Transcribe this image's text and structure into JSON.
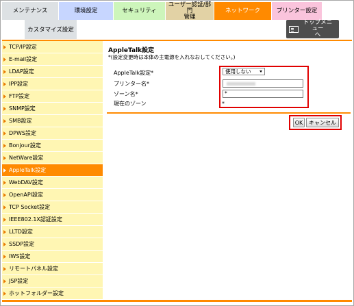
{
  "tabs": [
    {
      "label": "メンテナンス"
    },
    {
      "label": "環境設定"
    },
    {
      "label": "セキュリティ"
    },
    {
      "label": "ユーザー認証/部門\n管理"
    },
    {
      "label": "ネットワーク"
    },
    {
      "label": "プリンター設定"
    }
  ],
  "custom_tab": {
    "label": "カスタマイズ設定"
  },
  "top_menu": {
    "label": "トップメニュー\nへ"
  },
  "sidebar": {
    "items": [
      {
        "label": "TCP/IP設定"
      },
      {
        "label": "E-mail設定"
      },
      {
        "label": "LDAP設定"
      },
      {
        "label": "IPP設定"
      },
      {
        "label": "FTP設定"
      },
      {
        "label": "SNMP設定"
      },
      {
        "label": "SMB設定"
      },
      {
        "label": "DPWS設定"
      },
      {
        "label": "Bonjour設定"
      },
      {
        "label": "NetWare設定"
      },
      {
        "label": "AppleTalk設定"
      },
      {
        "label": "WebDAV設定"
      },
      {
        "label": "OpenAPI設定"
      },
      {
        "label": "TCP Socket設定"
      },
      {
        "label": "IEEE802.1X認証設定"
      },
      {
        "label": "LLTD設定"
      },
      {
        "label": "SSDP設定"
      },
      {
        "label": "IWS設定"
      },
      {
        "label": "リモートパネル設定"
      },
      {
        "label": "JSP設定"
      },
      {
        "label": "ホットフォルダー設定"
      }
    ],
    "active_index": 10
  },
  "main": {
    "title": "AppleTalk設定",
    "notice": "*(設定変更時は本体の主電源を入れなおしてください。)",
    "fields": {
      "appletalk_label": "AppleTalk設定*",
      "appletalk_value": "使用しない",
      "printer_name_label": "プリンター名*",
      "zone_name_label": "ゾーン名*",
      "zone_name_value": "*",
      "current_zone_label": "現在のゾーン",
      "current_zone_value": "*"
    },
    "buttons": {
      "ok": "OK",
      "cancel": "キャンセル"
    }
  },
  "colors": {
    "accent": "#ff8a00",
    "sidebar_bg": "#fff6b3",
    "highlight_box": "#e00000"
  }
}
